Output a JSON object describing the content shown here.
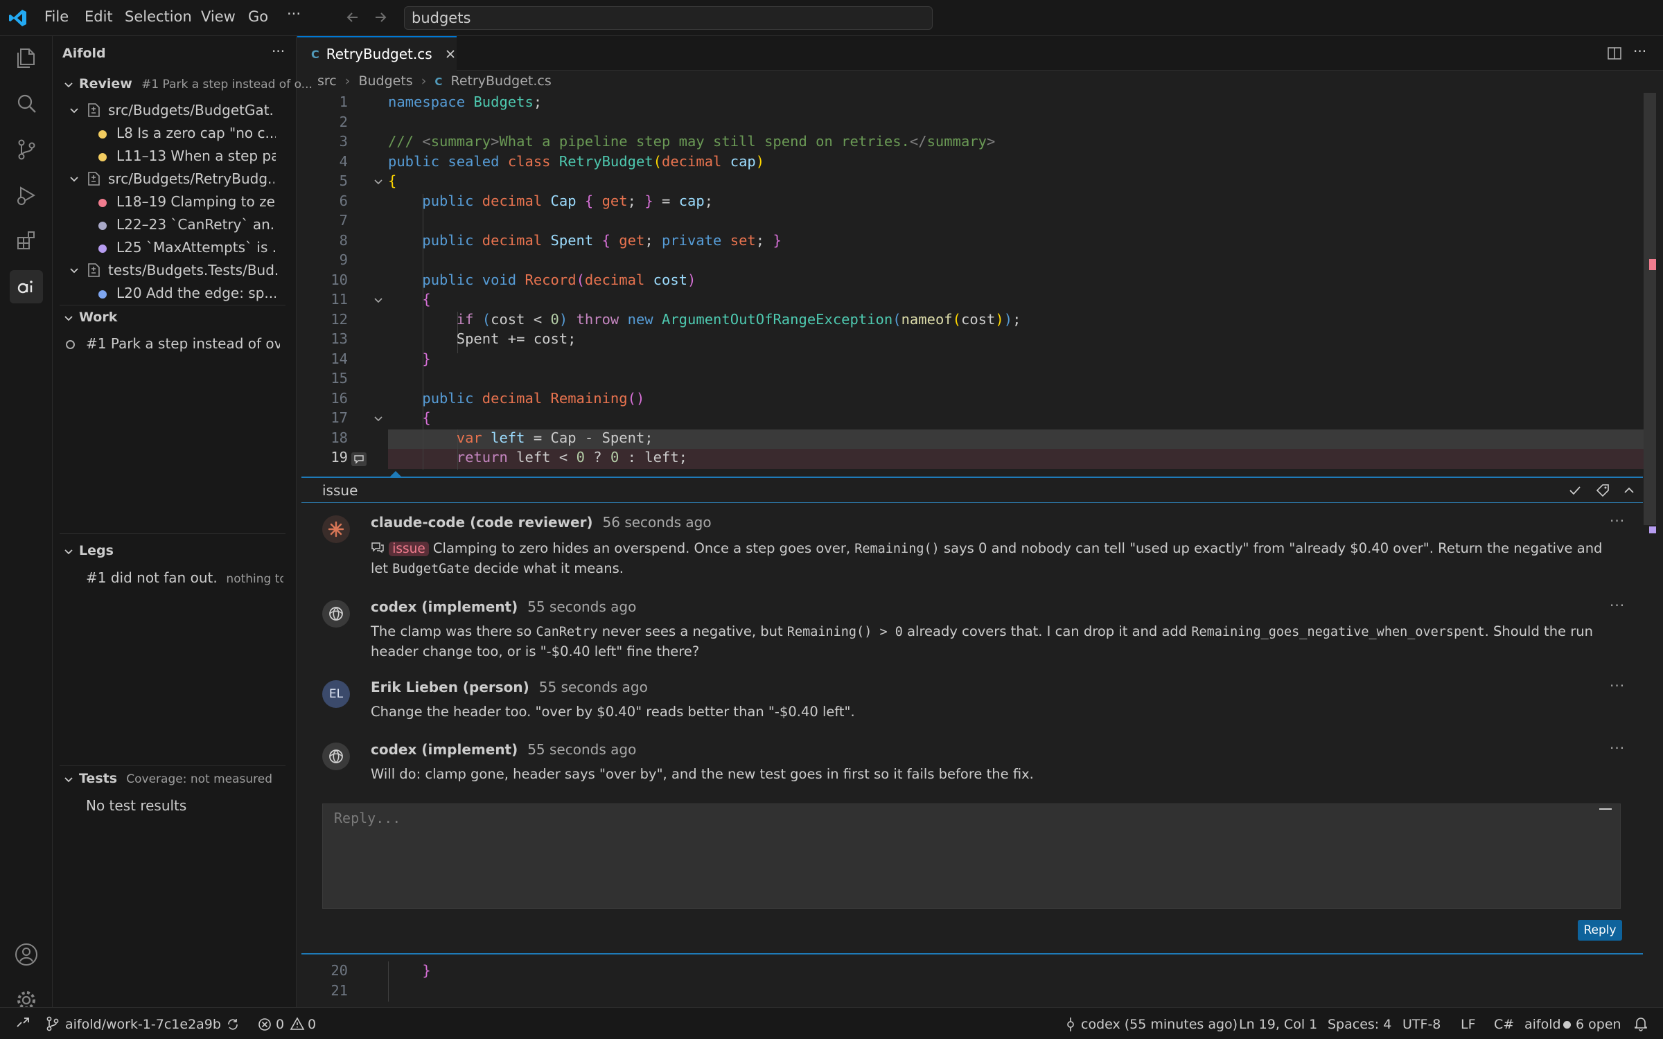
{
  "titlebar": {
    "menu": [
      "File",
      "Edit",
      "Selection",
      "View",
      "Go",
      "···"
    ],
    "command_center": "budgets"
  },
  "sidebar": {
    "title": "Aifold",
    "review": {
      "label": "Review",
      "subtitle": "#1 Park a step instead of o...",
      "files": [
        {
          "name": "src/Budgets/BudgetGat...",
          "items": [
            {
              "text": "L8  Is a zero cap \"no c...",
              "color": "#f2cc60"
            },
            {
              "text": "L11–13  When a step pa...",
              "color": "#f2cc60"
            }
          ]
        },
        {
          "name": "src/Budgets/RetryBudg...",
          "items": [
            {
              "text": "L18–19  Clamping to ze...",
              "color": "#f07c8e"
            },
            {
              "text": "L22–23  `CanRetry` an...",
              "color": "#a9a9c8"
            },
            {
              "text": "L25  `MaxAttempts` is ...",
              "color": "#b69cf0"
            }
          ]
        },
        {
          "name": "tests/Budgets.Tests/Bud...",
          "items": [
            {
              "text": "L20  Add the edge: sp...",
              "color": "#7ea6f0"
            }
          ]
        }
      ]
    },
    "work": {
      "label": "Work",
      "items": [
        "#1 Park a step instead of ov..."
      ]
    },
    "legs": {
      "label": "Legs",
      "item": "#1 did not fan out.",
      "item_note": "nothing to..."
    },
    "tests": {
      "label": "Tests",
      "subtitle": "Coverage: not measured",
      "empty": "No test results"
    }
  },
  "editor": {
    "tab": "RetryBudget.cs",
    "breadcrumb": [
      "src",
      "Budgets",
      "RetryBudget.cs"
    ],
    "line_numbers": [
      "1",
      "2",
      "3",
      "4",
      "5",
      "6",
      "7",
      "8",
      "9",
      "10",
      "11",
      "12",
      "13",
      "14",
      "15",
      "16",
      "17",
      "18",
      "19"
    ],
    "after_line_numbers": [
      "20",
      "21"
    ],
    "after_code": "    }"
  },
  "thread": {
    "label": "issue",
    "comments": [
      {
        "author": "claude-code (code reviewer)",
        "time": "56 seconds ago",
        "tag": "issue",
        "body_a": " Clamping to zero hides an overspend. Once a step goes over, ",
        "code_a": "Remaining()",
        "body_b": " says 0 and nobody can tell \"used up exactly\" from \"already $0.40 over\". Return the negative and let ",
        "code_b": "BudgetGate",
        "body_c": " decide what it means."
      },
      {
        "author": "codex (implement)",
        "time": "55 seconds ago",
        "body_a": "The clamp was there so ",
        "code_a": "CanRetry",
        "body_b": " never sees a negative, but ",
        "code_b": "Remaining() > 0",
        "body_c": " already covers that. I can drop it and add ",
        "code_c": "Remaining_goes_negative_when_overspent",
        "body_d": ". Should the run header change too, or is \"-$0.40 left\" fine there?"
      },
      {
        "author": "Erik Lieben (person)",
        "time": "55 seconds ago",
        "initials": "EL",
        "body": "Change the header too. \"over by $0.40\" reads better than \"-$0.40 left\"."
      },
      {
        "author": "codex (implement)",
        "time": "55 seconds ago",
        "body": "Will do: clamp gone, header says \"over by\", and the new test goes in first so it fails before the fix."
      }
    ],
    "reply_placeholder": "Reply...",
    "reply_button": "Reply"
  },
  "statusbar": {
    "branch": "aifold/work-1-7c1e2a9b",
    "errors": "0",
    "warnings": "0",
    "agent": "codex (55 minutes ago)",
    "position": "Ln 19, Col 1",
    "spaces": "Spaces: 4",
    "encoding": "UTF-8",
    "eol": "LF",
    "language": "C#",
    "workspace": "aifold",
    "open": "6 open"
  },
  "colors": {
    "accent": "#0078d4",
    "issue": "#f07c8e"
  }
}
